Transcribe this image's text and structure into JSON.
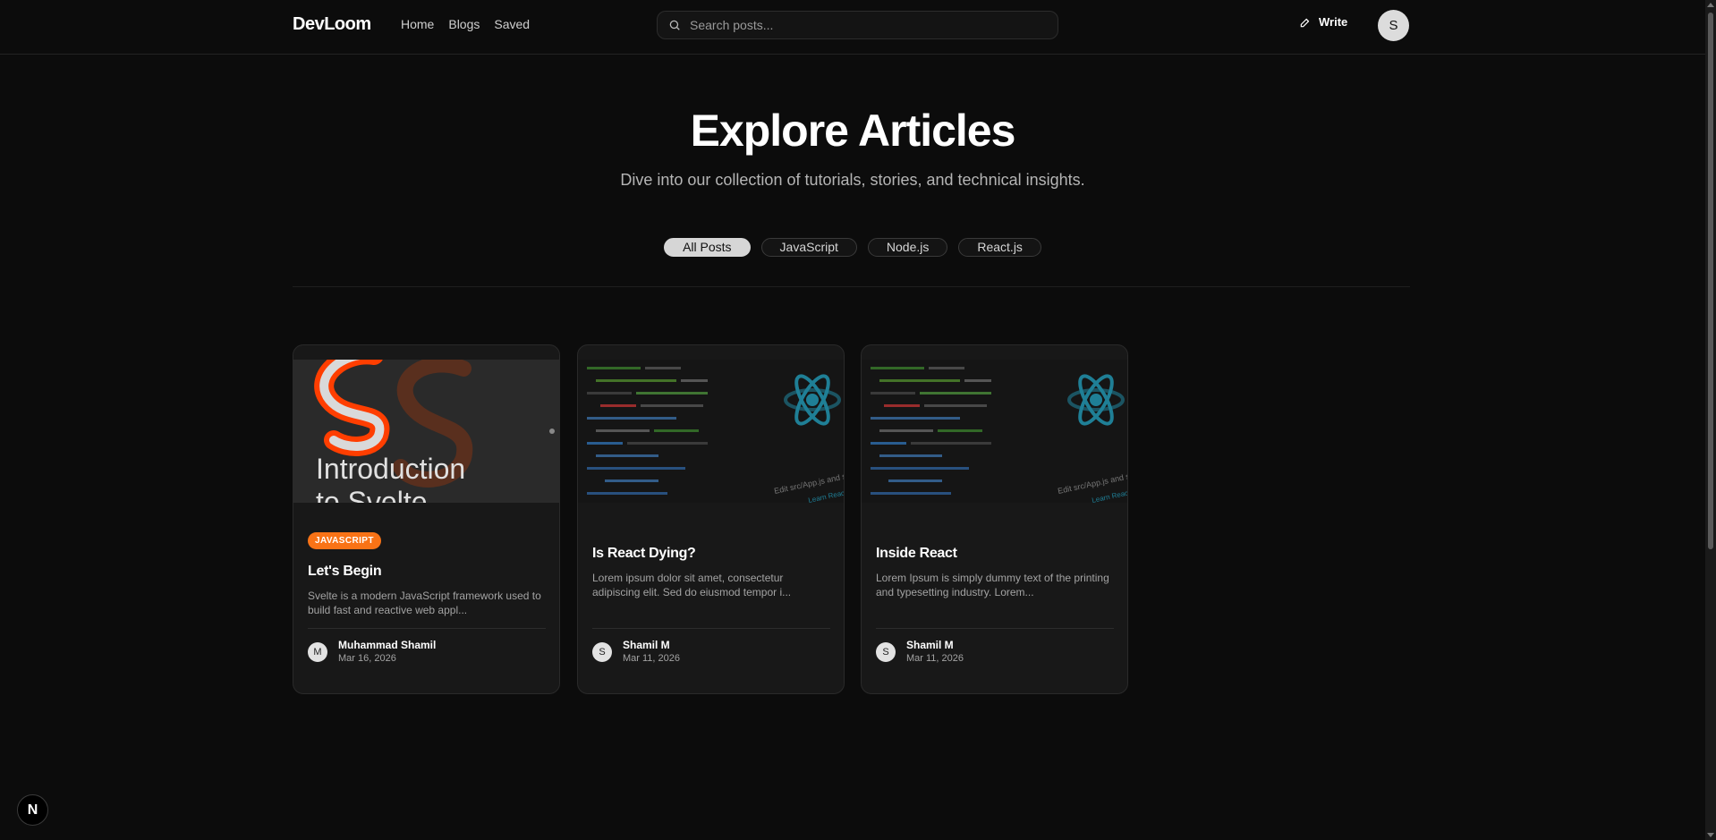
{
  "nav": {
    "brand": "DevLoom",
    "links": [
      "Home",
      "Blogs",
      "Saved"
    ],
    "search_placeholder": "Search posts...",
    "write_label": "Write",
    "avatar_initial": "S"
  },
  "hero": {
    "title": "Explore Articles",
    "subtitle": "Dive into our collection of tutorials, stories, and technical insights."
  },
  "filters": [
    {
      "label": "All Posts",
      "active": true
    },
    {
      "label": "JavaScript",
      "active": false
    },
    {
      "label": "Node.js",
      "active": false
    },
    {
      "label": "React.js",
      "active": false
    }
  ],
  "posts": [
    {
      "tag": "JAVASCRIPT",
      "title": "Let's Begin",
      "excerpt": "Svelte is a modern JavaScript framework used to build fast and reactive web appl...",
      "author": "Muhammad Shamil",
      "author_initial": "M",
      "date": "Mar 16, 2026",
      "cover_text": [
        "Introduction",
        "to Svelte"
      ]
    },
    {
      "tag": "",
      "title": "Is React Dying?",
      "excerpt": "Lorem ipsum dolor sit amet, consectetur adipiscing elit. Sed do eiusmod tempor i...",
      "author": "Shamil M",
      "author_initial": "S",
      "date": "Mar 11, 2026",
      "cover_text": [
        "Edit src/App.js and save to",
        "Learn React"
      ]
    },
    {
      "tag": "",
      "title": "Inside React",
      "excerpt": "Lorem Ipsum is simply dummy text of the printing and typesetting industry. Lorem...",
      "author": "Shamil M",
      "author_initial": "S",
      "date": "Mar 11, 2026",
      "cover_text": [
        "Edit src/App.js and save to",
        "Learn React"
      ]
    }
  ],
  "dev_indicator": "N",
  "colors": {
    "accent": "#f97316",
    "background": "#0c0c0c",
    "card": "#181818",
    "react_blue": "#1f7f96"
  }
}
